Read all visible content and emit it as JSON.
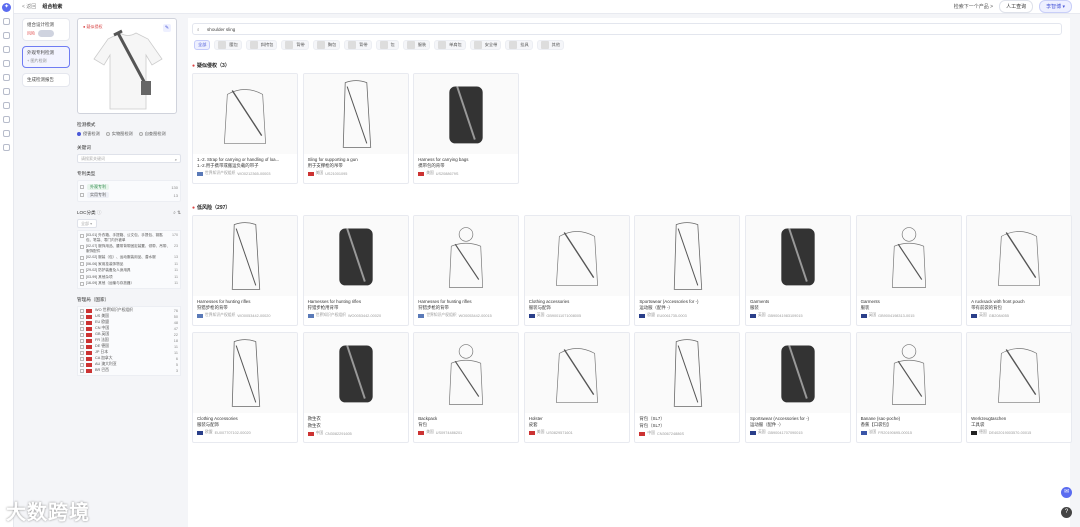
{
  "topbar": {
    "back": "< 返回",
    "title": "组合检索",
    "next": "检索下一个产品 >",
    "service": "人工查询",
    "user": "李智博 ▾"
  },
  "modes": [
    {
      "title": "组合设计检测",
      "status": "风险"
    },
    {
      "title": "外观专利检测",
      "status": "+ 图片检测"
    },
    {
      "title": "生成检测报告",
      "status": ""
    }
  ],
  "upload": {
    "tag": "疑似侵权"
  },
  "detect": {
    "label": "检测模式",
    "opts": [
      "侵害检测",
      "实物图检测",
      "自查图检测"
    ]
  },
  "keyword": {
    "label": "关键词",
    "placeholder": "请搜索关键词"
  },
  "patent_types": {
    "label": "专利类型",
    "items": [
      {
        "name": "外观专利",
        "count": "130"
      },
      {
        "name": "实用专利",
        "count": "13"
      }
    ]
  },
  "loc": {
    "label": "LOC分类",
    "all": "全部",
    "items": [
      {
        "t": "[03-01] 外衣箱、手提箱、公文包、手提包、钥匙包、笔袋、零门内外被单",
        "n": "170"
      },
      {
        "t": "[02-07] 服饰用品、腰带背带固定装置、领带、吊带、服饰配件",
        "n": "23"
      },
      {
        "t": "[02-02] 服装（包）、运动服装用品、潜水服",
        "n": "13"
      },
      {
        "t": "[06-06] 家用挂装饰物品",
        "n": "11"
      },
      {
        "t": "[29-02] 防护装备及人身用具",
        "n": "11"
      },
      {
        "t": "[03-99] 其他杂项",
        "n": "11"
      },
      {
        "t": "[16-09] 其他（运输与存放器）",
        "n": "11"
      }
    ]
  },
  "country": {
    "label": "管理局（国家）",
    "items": [
      {
        "name": "WO 世界知识产权组织",
        "n": "76"
      },
      {
        "name": "US 美国",
        "n": "50"
      },
      {
        "name": "EU 欧盟",
        "n": "48"
      },
      {
        "name": "CN 中国",
        "n": "47"
      },
      {
        "name": "GB 英国",
        "n": "22"
      },
      {
        "name": "FR 法国",
        "n": "18"
      },
      {
        "name": "DE 德国",
        "n": "11"
      },
      {
        "name": "JP 日本",
        "n": "11"
      },
      {
        "name": "CA 加拿大",
        "n": "6"
      },
      {
        "name": "AU 澳大利亚",
        "n": "5"
      },
      {
        "name": "BR 巴西",
        "n": "3"
      }
    ]
  },
  "search": {
    "value": "shoulder sling"
  },
  "chips": [
    "全部",
    "腰包",
    "斜挎包",
    "背带",
    "胸包",
    "背带",
    "包",
    "服装",
    "单肩包",
    "安全带",
    "挂具",
    "其他"
  ],
  "high_header": "疑似侵权（3）",
  "low_header": "低风险（297）",
  "high_cards": [
    {
      "t1": "1.-2. Strap for carrying or handling of loa...",
      "t2": "1.-2.用于携带或搬运负载的带子",
      "office": "世界知识产权组织",
      "num": "WO0212365-00003",
      "flag": "#5a7ab8"
    },
    {
      "t1": "Sling for supporting a gun",
      "t2": "用于支撑枪的吊带",
      "office": "美国",
      "num": "US21001095",
      "flag": "#c33"
    },
    {
      "t1": "Harness for carrying bags",
      "t2": "携带包的背带",
      "office": "美国",
      "num": "US2088679S",
      "flag": "#c33"
    }
  ],
  "low_cards": [
    {
      "t1": "Harnesses for hunting rifles",
      "t2": "狩猎步枪的背带",
      "office": "世界知识产权组织",
      "num": "WO0053442-00020",
      "flag": "#5a7ab8"
    },
    {
      "t1": "Harnesses for hunting rifles",
      "t2": "狩猎步枪用背带",
      "office": "世界知识产权组织",
      "num": "WO0053442-00020",
      "flag": "#5a7ab8"
    },
    {
      "t1": "Harnesses for hunting rifles",
      "t2": "狩猎步枪的背带",
      "office": "世界知识产权组织",
      "num": "WO0053442-00015",
      "flag": "#5a7ab8"
    },
    {
      "t1": "Clothing accessories",
      "t2": "服装与配饰",
      "office": "英国",
      "num": "GB90011071008005",
      "flag": "#2a3f8a"
    },
    {
      "t1": "Sportswear (Accessories for -)",
      "t2": "运动服（配件 -）",
      "office": "欧盟",
      "num": "EU0061735-0003",
      "flag": "#2a3f8a"
    },
    {
      "t1": "Garments",
      "t2": "服装",
      "office": "英国",
      "num": "GB90041983109015",
      "flag": "#2a3f8a"
    },
    {
      "t1": "Garments",
      "t2": "服装",
      "office": "英国",
      "num": "GB9004198313-0015",
      "flag": "#2a3f8a"
    },
    {
      "t1": "A rucksack with front pouch",
      "t2": "带有前袋的背包",
      "office": "英国",
      "num": "GB2084055",
      "flag": "#2a3f8a"
    },
    {
      "t1": "Clothing Accessories",
      "t2": "服装与配饰",
      "office": "欧盟",
      "num": "EU007707102-00020",
      "flag": "#2a3f8a"
    },
    {
      "t1": "救生衣",
      "t2": "救生衣",
      "office": "中国",
      "num": "CN3082291605",
      "flag": "#c33"
    },
    {
      "t1": "Backpack",
      "t2": "背包",
      "office": "美国",
      "num": "US0974486201",
      "flag": "#c33"
    },
    {
      "t1": "Holster",
      "t2": "皮套",
      "office": "美国",
      "num": "US0829571601",
      "flag": "#c33"
    },
    {
      "t1": "背包（SL7）",
      "t2": "背包（SL7）",
      "office": "中国",
      "num": "CN306724886S",
      "flag": "#c33"
    },
    {
      "t1": "Sportswear (Accessories for -)",
      "t2": "运动服（配件 -）",
      "office": "英国",
      "num": "GB90041707090015",
      "flag": "#2a3f8a"
    },
    {
      "t1": "Banane (sac-poche)",
      "t2": "香蕉【口袋包】",
      "office": "法国",
      "num": "FR20190695-00015",
      "flag": "#3a55a8"
    },
    {
      "t1": "Werkzeugtaschen",
      "t2": "工具袋",
      "office": "德国",
      "num": "DE402019003570-00015",
      "flag": "#222"
    }
  ],
  "watermark": "大数跨境"
}
